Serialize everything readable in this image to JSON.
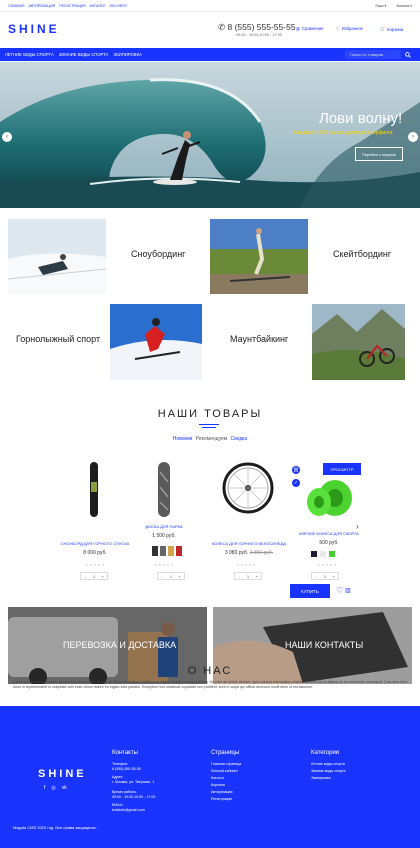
{
  "topbar": {
    "links": [
      "Главная",
      "Авторизация",
      "Регистрация",
      "Каталог",
      "Delivery"
    ],
    "lang": "Язык",
    "currency": "Валюта"
  },
  "header": {
    "logo": "SHINE",
    "phone": "8 (555) 555-55-55",
    "hours": "09:00 - 19:00,10:00 - 17:00",
    "compare": "Сравнение",
    "favorites": "Избранное",
    "cart": "Корзина"
  },
  "nav": {
    "items": [
      "Летние виды спорта",
      "Зимние виды спорта",
      "Экипировка"
    ],
    "search_placeholder": "Поиск по товарам"
  },
  "hero": {
    "title": "Лови волну!",
    "subtitle": "Скидки от 30% на все доски для серфинга",
    "button": "Перейти к покупке"
  },
  "categories": [
    "Сноубординг",
    "Скейтбординг",
    "Горнолыжный спорт",
    "Маунтбайкинг"
  ],
  "products": {
    "title": "НАШИ ТОВАРЫ",
    "tabs": [
      "Новинки",
      "Рекомендуем",
      "Скидка"
    ],
    "items": [
      {
        "name": "Сноуборд для горного спуска",
        "price": "8 000 руб."
      },
      {
        "name": "Доска для парка",
        "price": "1 500 руб."
      },
      {
        "name": "Колеса для горного велосипеда",
        "price": "3 080 руб.",
        "old_price": "3 850 руб."
      },
      {
        "name": "Мягкие колеса для скейта",
        "price": "500 руб."
      }
    ],
    "quick_view": "Просмотр",
    "buy": "Купить",
    "qty": "1",
    "minus": "-",
    "plus": "+"
  },
  "banners": [
    "Перевозка и доставка",
    "Наши контакты"
  ],
  "about": {
    "title": "О НАС",
    "text": "Lorem ipsum dolor sit amet, consectetur adipiscing elit, sed do eiusmod tempor incididunt ut labore et dolore magna aliqua. Ut enim ad minim veniam, quis nostrud exercitation ullamco laboris nisi ut aliquip ex ea commodo consequat. Duis aute irure dolor in reprehenderit in voluptate velit esse cillum dolore eu fugiat nulla pariatur. Excepteur sint occaecat cupidatat non proident, sunt in culpa qui officia deserunt mollit anim id est laborum."
  },
  "footer": {
    "logo": "SHINE",
    "contacts_title": "Контакты",
    "phone_label": "Телефон:",
    "phone": "8 (555) 555-55-55",
    "address_label": "Адрес:",
    "address": "г. Москва, ул. Тверская, 1",
    "hours_label": "Время работы:",
    "hours": "09:00 - 19:00,10:00 - 17:00",
    "email_label": "EMAIL:",
    "email": "bcfabde@gmail.com",
    "pages_title": "Страницы",
    "pages": [
      "Главная страница",
      "Личный кабинет",
      "Каталог",
      "Корзина",
      "Авторизация",
      "Регистрация"
    ],
    "categories_title": "Категории",
    "categories": [
      "Летние виды спорта",
      "Зимние виды спорта",
      "Экипировка"
    ],
    "copyright": "Magula CMS 2020 год. Все права защищены."
  },
  "colors": {
    "accent": "#1a34ff",
    "hero_subtitle": "#ffd900"
  }
}
